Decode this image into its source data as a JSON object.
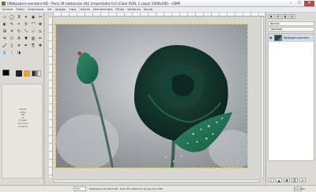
{
  "window": {
    "title": "[Wallpapers-wonders-HD - Puck 39 (obtacular (8)] (importada)-0.0 (Color RGB, 1 capa) 1006x200 – GIMP",
    "controls": [
      "–",
      "☐",
      "✕"
    ]
  },
  "menu": [
    "Archivo",
    "Editar",
    "Seleccionar",
    "Ver",
    "Imagen",
    "Capa",
    "Colores",
    "Herramientas",
    "Filtros",
    "Ventanas",
    "Ayuda"
  ],
  "toolbox": {
    "tools": [
      {
        "icon": "rect-select-icon",
        "glyph": "▭"
      },
      {
        "icon": "ellipse-select-icon",
        "glyph": "◯"
      },
      {
        "icon": "free-select-icon",
        "glyph": "ϑ"
      },
      {
        "icon": "fuzzy-select-icon",
        "glyph": "✶"
      },
      {
        "icon": "color-select-icon",
        "glyph": "◉"
      },
      {
        "icon": "scissors-icon",
        "glyph": "✂"
      },
      {
        "icon": "foreground-select-icon",
        "glyph": "◐"
      },
      {
        "icon": "paths-icon",
        "glyph": "✎"
      },
      {
        "icon": "color-picker-icon",
        "glyph": "✑"
      },
      {
        "icon": "zoom-icon",
        "glyph": "⚲"
      },
      {
        "icon": "measure-icon",
        "glyph": "⌒"
      },
      {
        "icon": "move-icon",
        "glyph": "✥"
      },
      {
        "icon": "align-icon",
        "glyph": "⊞"
      },
      {
        "icon": "crop-icon",
        "glyph": "⌗"
      },
      {
        "icon": "rotate-icon",
        "glyph": "↻"
      },
      {
        "icon": "scale-icon",
        "glyph": "⤡"
      },
      {
        "icon": "shear-icon",
        "glyph": "▱"
      },
      {
        "icon": "perspective-icon",
        "glyph": "⏢"
      },
      {
        "icon": "flip-icon",
        "glyph": "⇋"
      },
      {
        "icon": "cage-icon",
        "glyph": "⬠"
      },
      {
        "icon": "text-icon",
        "glyph": "A"
      },
      {
        "icon": "bucket-fill-icon",
        "glyph": "▼"
      },
      {
        "icon": "blend-icon",
        "glyph": "▥"
      },
      {
        "icon": "pencil-icon",
        "glyph": "✏"
      },
      {
        "icon": "paintbrush-icon",
        "glyph": "🖌"
      },
      {
        "icon": "eraser-icon",
        "glyph": "▯"
      },
      {
        "icon": "airbrush-icon",
        "glyph": "✈"
      },
      {
        "icon": "ink-icon",
        "glyph": "✒"
      },
      {
        "icon": "clone-icon",
        "glyph": "⎘"
      },
      {
        "icon": "heal-icon",
        "glyph": "✚"
      },
      {
        "icon": "blur-icon",
        "glyph": "💧"
      },
      {
        "icon": "smudge-icon",
        "glyph": "☝"
      },
      {
        "icon": "dodge-burn-icon",
        "glyph": "◑"
      }
    ],
    "hint": [
      "Puede",
      "soltar",
      "BD",
      "de",
      "imagen",
      "aquí para",
      "arrastrar"
    ]
  },
  "dock": {
    "tabs": [
      "▣",
      "▤",
      "▦",
      "▧"
    ],
    "mode_label": "Normal",
    "opacity_label": "Opacidad",
    "layer_name": "Wallpapers-wonders"
  },
  "status": {
    "coords": "",
    "zoom": "50%",
    "text": "Wallpapers-wonders-HD - Puck 39 (obtacular (8) jpg (23,5 KB)",
    "cancel": "Cancelar"
  }
}
